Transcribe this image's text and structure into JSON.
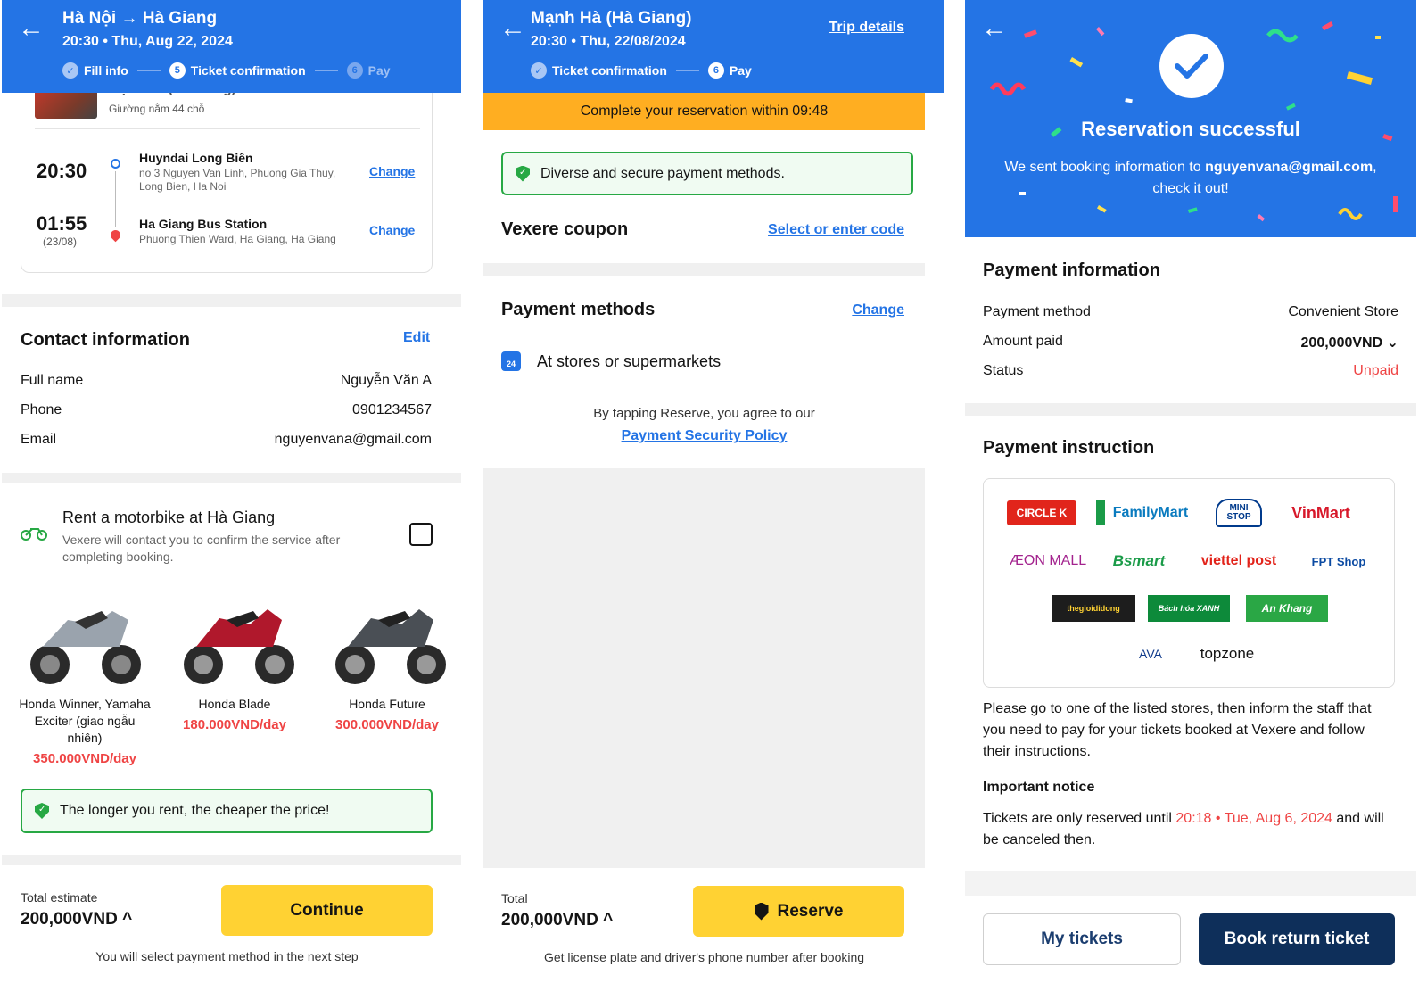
{
  "screen1": {
    "header": {
      "title": "Hà Nội → Hà Giang",
      "subtitle": "20:30 • Thu, Aug 22, 2024",
      "steps": [
        {
          "num": "✓",
          "label": "Fill info"
        },
        {
          "num": "5",
          "label": "Ticket confirmation"
        },
        {
          "num": "6",
          "label": "Pay"
        }
      ]
    },
    "trip": {
      "operator": "Mạnh Hà (Hà Giang)",
      "vehicle": "Giường nằm 44 chỗ",
      "depart_time": "20:30",
      "depart_name": "Huyndai Long Biên",
      "depart_addr": "no 3 Nguyen Van Linh, Phuong Gia Thuy, Long Bien, Ha Noi",
      "arrive_time": "01:55",
      "arrive_date": "(23/08)",
      "arrive_name": "Ha Giang Bus Station",
      "arrive_addr": "Phuong Thien Ward, Ha Giang, Ha Giang",
      "change_label": "Change"
    },
    "contact": {
      "title": "Contact information",
      "edit_label": "Edit",
      "fields": [
        {
          "label": "Full name",
          "value": "Nguyễn Văn A"
        },
        {
          "label": "Phone",
          "value": "0901234567"
        },
        {
          "label": "Email",
          "value": "nguyenvana@gmail.com"
        }
      ]
    },
    "rental": {
      "title": "Rent a motorbike at Hà Giang",
      "desc": "Vexere will contact you to confirm the service after completing booking.",
      "bikes": [
        {
          "name": "Honda Winner, Yamaha Exciter (giao ngẫu nhiên)",
          "price": "350.000VND/day",
          "color": "#9aa3ad"
        },
        {
          "name": "Honda Blade",
          "price": "180.000VND/day",
          "color": "#b0182c"
        },
        {
          "name": "Honda Future",
          "price": "300.000VND/day",
          "color": "#4a4f55"
        }
      ],
      "tip": "The longer you rent, the cheaper the price!"
    },
    "footer": {
      "total_label": "Total estimate",
      "total_value": "200,000VND ^",
      "button": "Continue",
      "note": "You will select payment method in the next step"
    }
  },
  "screen2": {
    "header": {
      "title": "Mạnh Hà (Hà Giang)",
      "subtitle": "20:30 • Thu, 22/08/2024",
      "trip_details": "Trip details",
      "steps": [
        {
          "num": "✓",
          "label": "Ticket confirmation"
        },
        {
          "num": "6",
          "label": "Pay"
        }
      ]
    },
    "timer": "Complete your reservation within 09:48",
    "secure": "Diverse and secure payment methods.",
    "coupon": {
      "title": "Vexere coupon",
      "action": "Select or enter code"
    },
    "payment": {
      "title": "Payment methods",
      "change": "Change",
      "method": "At stores or supermarkets"
    },
    "agree_text": "By tapping Reserve, you agree to our",
    "policy_link": "Payment Security Policy",
    "footer": {
      "total_label": "Total",
      "total_value": "200,000VND ^",
      "button": "Reserve",
      "note": "Get license plate and driver's phone number after booking"
    }
  },
  "screen3": {
    "hero": {
      "title": "Reservation successful",
      "msg_pre": "We sent booking information to ",
      "email": "nguyenvana@gmail.com",
      "msg_post": ",",
      "msg_line2": "check it out!"
    },
    "info": {
      "title": "Payment information",
      "rows": [
        {
          "label": "Payment method",
          "value": "Convenient Store"
        },
        {
          "label": "Amount paid",
          "value": "200,000VND ⌄"
        },
        {
          "label": "Status",
          "value": "Unpaid"
        }
      ]
    },
    "instruction": {
      "title": "Payment instruction",
      "stores": [
        "CIRCLE K",
        "FamilyMart",
        "MINI STOP",
        "VinMart",
        "ÆON MALL",
        "Bsmart",
        "viettel post",
        "FPT Shop",
        "thegioididong",
        "Bách hóa XANH",
        "An Khang",
        "AVA",
        "topzone"
      ],
      "text": "Please go to one of the listed stores, then inform the staff that you need to pay for your tickets booked at Vexere and follow their instructions.",
      "notice_title": "Important notice",
      "notice_pre": "Tickets are only reserved until ",
      "notice_time": "20:18",
      "notice_dot": " • ",
      "notice_date": "Tue, Aug 6, 2024",
      "notice_post": " and will be canceled then."
    },
    "buttons": {
      "my_tickets": "My tickets",
      "return": "Book return ticket"
    },
    "colors": {
      "primary": "#2474e5",
      "navy": "#0e2f5a",
      "yellow": "#ffd233",
      "green": "#27a844",
      "red": "#ef4444"
    }
  }
}
